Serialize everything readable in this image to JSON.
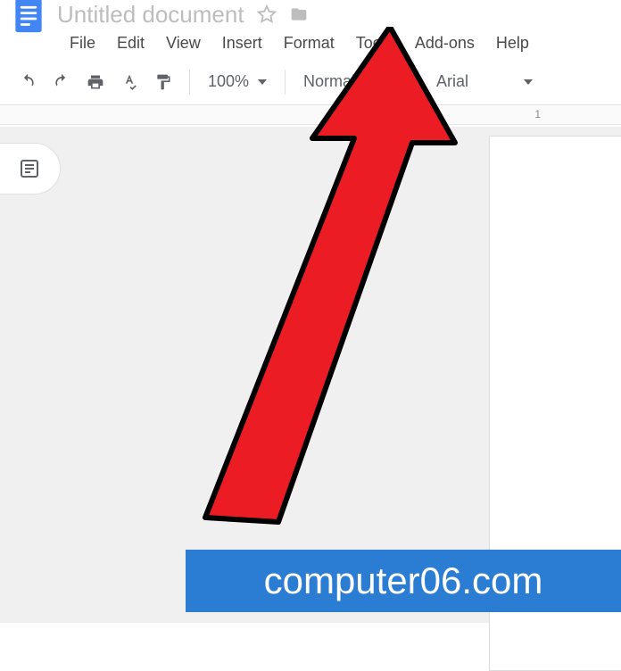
{
  "doc": {
    "title": "Untitled document"
  },
  "menubar": {
    "file": "File",
    "edit": "Edit",
    "view": "View",
    "insert": "Insert",
    "format": "Format",
    "tools": "Tools",
    "addons": "Add-ons",
    "help": "Help"
  },
  "toolbar": {
    "zoom": "100%",
    "style": "Normal",
    "font": "Arial"
  },
  "ruler": {
    "mark": "1"
  },
  "watermark": "computer06.com"
}
